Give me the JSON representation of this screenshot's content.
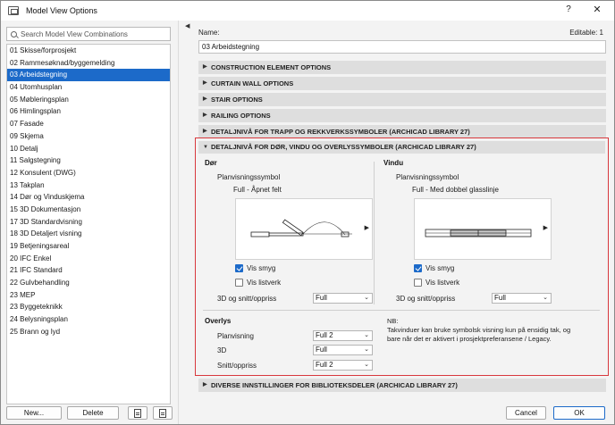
{
  "window": {
    "title": "Model View Options",
    "help_label": "?",
    "close_label": "✕"
  },
  "search": {
    "placeholder": "Search Model View Combinations"
  },
  "combinations": [
    "01 Skisse/forprosjekt",
    "02 Rammesøknad/byggemelding",
    "03 Arbeidstegning",
    "04 Utomhusplan",
    "05 Møbleringsplan",
    "06 Himlingsplan",
    "07 Fasade",
    "09 Skjema",
    "10 Detalj",
    "11 Salgstegning",
    "12 Konsulent (DWG)",
    "13 Takplan",
    "14 Dør og Vinduskjema",
    "15 3D Dokumentasjon",
    "17 3D Standardvisning",
    "18 3D Detaljert visning",
    "19 Betjeningsareal",
    "20 IFC Enkel",
    "21 IFC Standard",
    "22 Gulvbehandling",
    "23 MEP",
    "23 Byggeteknikk",
    "24 Belysningsplan",
    "25 Brann og lyd"
  ],
  "selected_index": 2,
  "left_buttons": {
    "new": "New...",
    "delete": "Delete"
  },
  "name": {
    "label": "Name:",
    "value": "03 Arbeidstegning",
    "editable": "Editable: 1"
  },
  "sections": [
    "CONSTRUCTION ELEMENT OPTIONS",
    "CURTAIN WALL OPTIONS",
    "STAIR OPTIONS",
    "RAILING OPTIONS",
    "DETALJNIVÅ FOR TRAPP OG REKKVERKSSYMBOLER (ARCHICAD LIBRARY 27)"
  ],
  "expanded": {
    "title": "DETALJNIVÅ FOR DØR, VINDU OG OVERLYSSYMBOLER (ARCHICAD LIBRARY 27)",
    "door": {
      "title": "Dør",
      "plan_symbol_label": "Planvisningssymbol",
      "plan_symbol_value": "Full - Åpnet felt",
      "vis_smyg": "Vis smyg",
      "vis_smyg_checked": true,
      "vis_listverk": "Vis listverk",
      "vis_listverk_checked": false,
      "section_label": "3D og snitt/oppriss",
      "section_value": "Full"
    },
    "window": {
      "title": "Vindu",
      "plan_symbol_label": "Planvisningssymbol",
      "plan_symbol_value": "Full - Med dobbel glasslinje",
      "vis_smyg": "Vis smyg",
      "vis_smyg_checked": true,
      "vis_listverk": "Vis listverk",
      "vis_listverk_checked": false,
      "section_label": "3D og snitt/oppriss",
      "section_value": "Full"
    },
    "overlys": {
      "title": "Overlys",
      "rows": [
        {
          "label": "Planvisning",
          "value": "Full 2"
        },
        {
          "label": "3D",
          "value": "Full"
        },
        {
          "label": "Snitt/oppriss",
          "value": "Full 2"
        }
      ]
    },
    "nb_label": "NB:",
    "nb_text": "Takvinduer kan bruke symbolsk visning kun på ensidig tak, og bare når det er aktivert i prosjektpreferansene / Legacy."
  },
  "bottom_section": "DIVERSE INNSTILLINGER FOR BIBLIOTEKSDELER (ARCHICAD LIBRARY 27)",
  "dialog_buttons": {
    "cancel": "Cancel",
    "ok": "OK"
  },
  "colors": {
    "selection": "#1c6ac9",
    "highlight_border": "#d8383d",
    "section_bg": "#dedede"
  },
  "icons": [
    "app-icon",
    "search-icon",
    "caret-right-icon",
    "caret-down-icon",
    "chevron-down-icon",
    "duplicate-icon",
    "import-icon"
  ]
}
